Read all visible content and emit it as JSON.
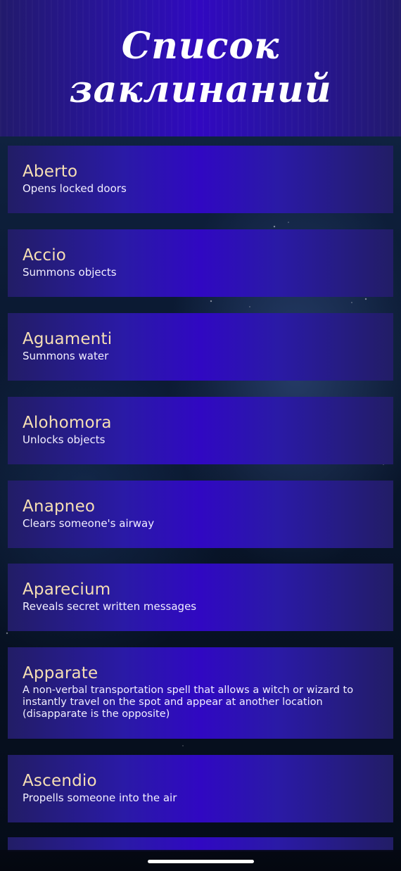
{
  "header": {
    "title": "Список заклинаний"
  },
  "spells": [
    {
      "name": "Aberto",
      "description": "Opens locked doors"
    },
    {
      "name": "Accio",
      "description": "Summons objects"
    },
    {
      "name": "Aguamenti",
      "description": "Summons water"
    },
    {
      "name": "Alohomora",
      "description": "Unlocks objects"
    },
    {
      "name": "Anapneo",
      "description": "Clears someone's airway"
    },
    {
      "name": "Aparecium",
      "description": "Reveals secret written messages"
    },
    {
      "name": "Apparate",
      "description": "A non-verbal transportation spell that allows a witch or wizard to instantly travel on the spot and appear at another location (disapparate is the opposite)"
    },
    {
      "name": "Ascendio",
      "description": "Propells someone into the air"
    }
  ],
  "colors": {
    "spell_name": "#f6dfb4",
    "card_center": "#3008c2",
    "card_edge": "#221d66"
  }
}
